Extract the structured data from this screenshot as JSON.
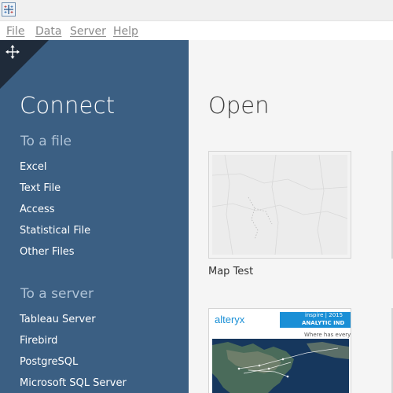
{
  "menu": {
    "file": "File",
    "data": "Data",
    "server": "Server",
    "help": "Help"
  },
  "connect": {
    "title": "Connect",
    "to_a_file": {
      "heading": "To a file",
      "items": [
        "Excel",
        "Text File",
        "Access",
        "Statistical File",
        "Other Files"
      ]
    },
    "to_a_server": {
      "heading": "To a server",
      "items": [
        "Tableau Server",
        "Firebird",
        "PostgreSQL",
        "Microsoft SQL Server"
      ]
    }
  },
  "open": {
    "title": "Open",
    "workbooks": [
      {
        "label": "Map Test"
      },
      {
        "label": "",
        "logo_text": "alteryx",
        "banner_top": "inspire | 2015",
        "banner_main": "ANALYTIC IND",
        "subtitle": "Where has everyo"
      }
    ]
  },
  "colors": {
    "sidebar": "#3b5f83",
    "sidebar_corner": "#1f2b3a",
    "main_bg": "#f5f5f5",
    "alteryx_blue": "#1a8fd6",
    "map_ocean": "#16375d"
  }
}
